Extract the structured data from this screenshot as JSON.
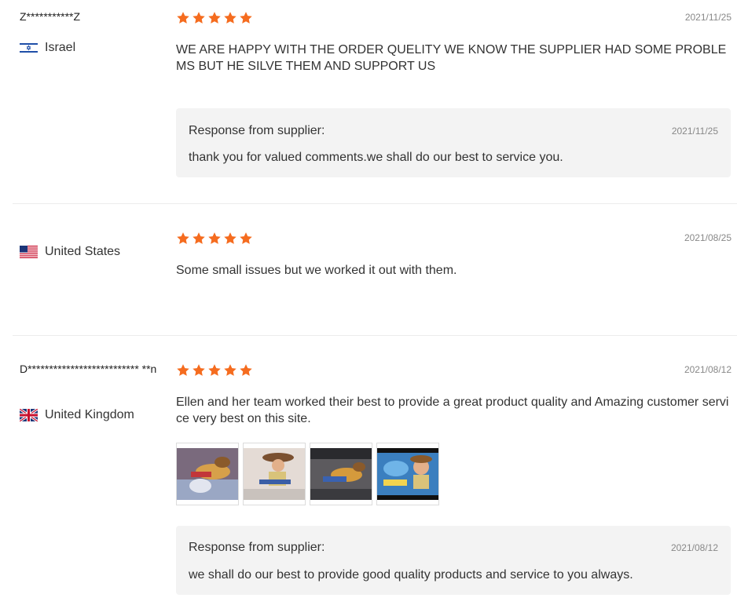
{
  "reviews": [
    {
      "user": "Z***********Z",
      "country": "Israel",
      "flag": "israel-flag",
      "rating": 5,
      "date": "2021/11/25",
      "text": "WE ARE HAPPY WITH THE ORDER QUELITY WE KNOW THE SUPPLIER HAD SOME PROBLEMS BUT HE SILVE THEM AND SUPPORT US",
      "response": {
        "title": "Response from supplier:",
        "date": "2021/11/25",
        "text": "thank you for valued comments.we shall do our best to service you."
      }
    },
    {
      "user": "",
      "country": "United States",
      "flag": "us-flag",
      "rating": 5,
      "date": "2021/08/25",
      "text": "Some small issues but we worked it out with them."
    },
    {
      "user": "D************************** **n",
      "country": "United Kingdom",
      "flag": "uk-flag",
      "rating": 5,
      "date": "2021/08/12",
      "text": "Ellen and her team worked their best to provide a great product quality and Amazing customer service very best on this site.",
      "photos": [
        "toy-figure-photo-1",
        "toy-figure-photo-2",
        "toy-figure-photo-3",
        "toy-figure-photo-4"
      ],
      "response": {
        "title": "Response from supplier:",
        "date": "2021/08/12",
        "text": "we shall do our best to provide good quality products and service to you always."
      }
    }
  ],
  "colors": {
    "star": "#f56c1f",
    "response_bg": "#f3f3f3",
    "date": "#888888",
    "divider": "#ececec"
  }
}
